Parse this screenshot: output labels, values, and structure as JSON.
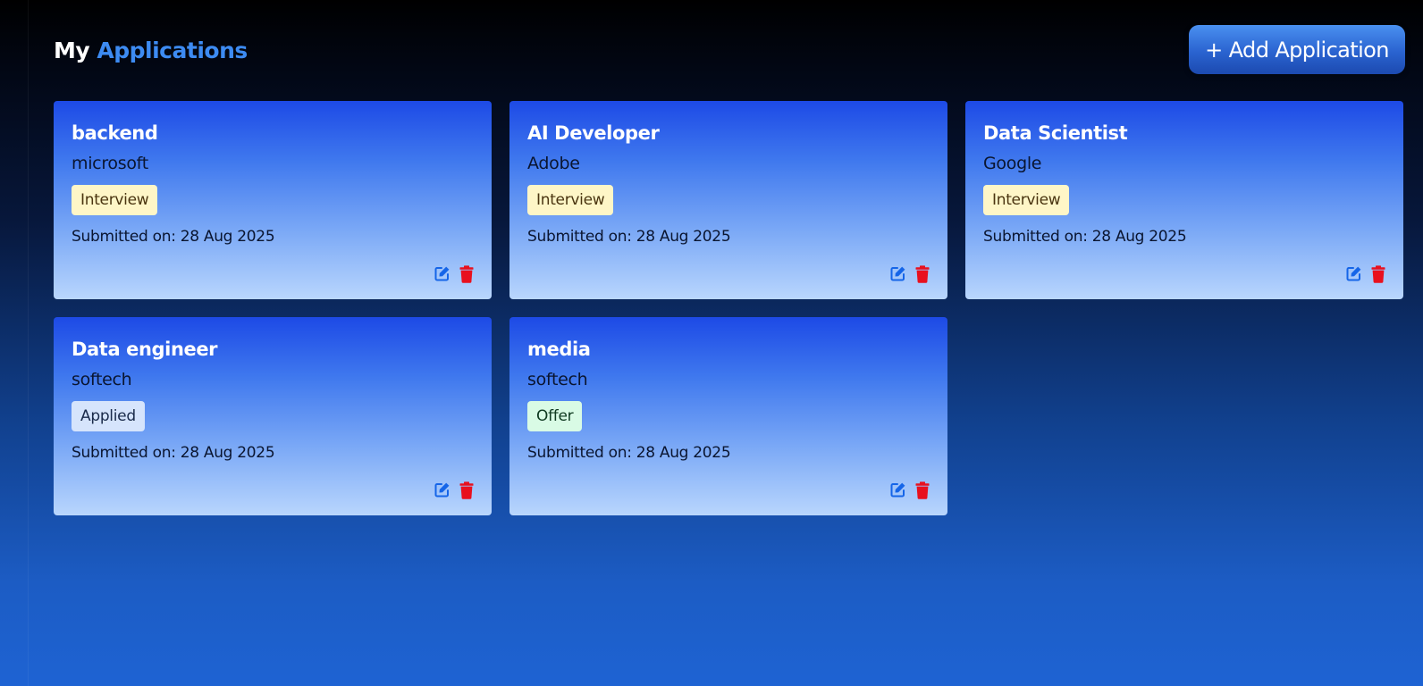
{
  "header": {
    "title_prefix": "My",
    "title_highlight": "Applications",
    "add_button_label": "+ Add Application"
  },
  "colors": {
    "accent": "#3d8bf2",
    "edit_icon": "#1565e8",
    "delete_icon": "#e8101e"
  },
  "applications": [
    {
      "title": "backend",
      "company": "microsoft",
      "status": "Interview",
      "submitted": "Submitted on: 28 Aug 2025"
    },
    {
      "title": "AI Developer",
      "company": "Adobe",
      "status": "Interview",
      "submitted": "Submitted on: 28 Aug 2025"
    },
    {
      "title": "Data Scientist",
      "company": "Google",
      "status": "Interview",
      "submitted": "Submitted on: 28 Aug 2025"
    },
    {
      "title": "Data engineer",
      "company": "softech",
      "status": "Applied",
      "submitted": "Submitted on: 28 Aug 2025"
    },
    {
      "title": "media",
      "company": "softech",
      "status": "Offer",
      "submitted": "Submitted on: 28 Aug 2025"
    }
  ],
  "icons": {
    "edit": "edit-icon",
    "delete": "trash-icon"
  }
}
